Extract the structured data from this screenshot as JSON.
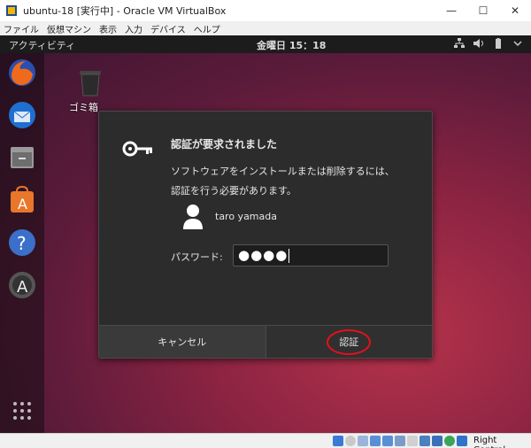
{
  "window": {
    "title": "ubuntu-18 [実行中] - Oracle VM VirtualBox"
  },
  "menu": [
    "ファイル",
    "仮想マシン",
    "表示",
    "入力",
    "デバイス",
    "ヘルプ"
  ],
  "topbar": {
    "activities": "アクティビティ",
    "clock": "金曜日 15：18"
  },
  "desktop": {
    "trash_label": "ゴミ箱"
  },
  "dialog": {
    "title": "認証が要求されました",
    "message_line1": "ソフトウェアをインストールまたは削除するには、",
    "message_line2": "認証を行う必要があります。",
    "user_name": "taro yamada",
    "password_label": "パスワード:",
    "password_value": "●●●●",
    "cancel_label": "キャンセル",
    "auth_label": "認証"
  },
  "statusbar": {
    "host_key": "Right Control"
  },
  "colors": {
    "highlight": "#e5101b",
    "dialog_bg": "#2c2c2c"
  }
}
